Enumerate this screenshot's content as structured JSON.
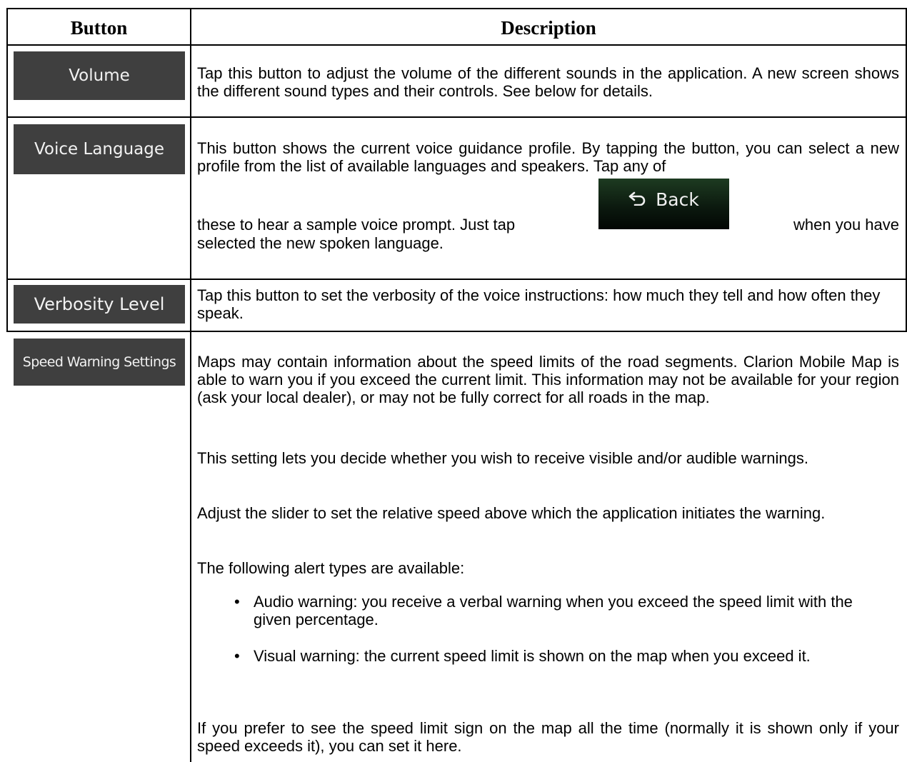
{
  "table": {
    "headers": {
      "button": "Button",
      "description": "Description"
    },
    "rows": [
      {
        "button_label": "Volume",
        "description": "Tap this button to adjust the volume of the different sounds in the application. A new screen shows the different sound types and their controls. See below for details."
      },
      {
        "button_label": "Voice Language",
        "description_part1": "This button shows the current voice guidance profile. By tapping the button, you can select a new profile from the list of available languages and speakers. Tap any of",
        "description_part2_before": "these to hear a sample voice prompt. Just tap",
        "description_part2_after": "when you have",
        "description_part3": "selected the new spoken language.",
        "inline_button": {
          "label": "Back",
          "icon": "back-arrow-icon"
        }
      },
      {
        "button_label": "Verbosity Level",
        "description": "Tap this button to set the verbosity of the voice instructions: how much they tell and how often they speak."
      },
      {
        "button_label": "Speed Warning Settings",
        "paragraphs": [
          "Maps may contain information about the speed limits of the road segments. Clarion Mobile Map is able to warn you if you exceed the current limit. This information may not be available for your region (ask your local dealer), or may not be fully correct for all roads in the map.",
          "This setting lets you decide whether you wish to receive visible and/or audible warnings.",
          "Adjust the slider to set the relative speed above which the application initiates the warning.",
          "The following alert types are available:"
        ],
        "bullets": [
          "Audio warning: you receive a verbal warning when you exceed the speed limit with the given percentage.",
          "Visual warning: the current speed limit is shown on the map when you exceed it."
        ],
        "closing": "If you prefer to see the speed limit sign on the map all the time (normally it is shown only if your speed exceeds it), you can set it here."
      }
    ]
  }
}
